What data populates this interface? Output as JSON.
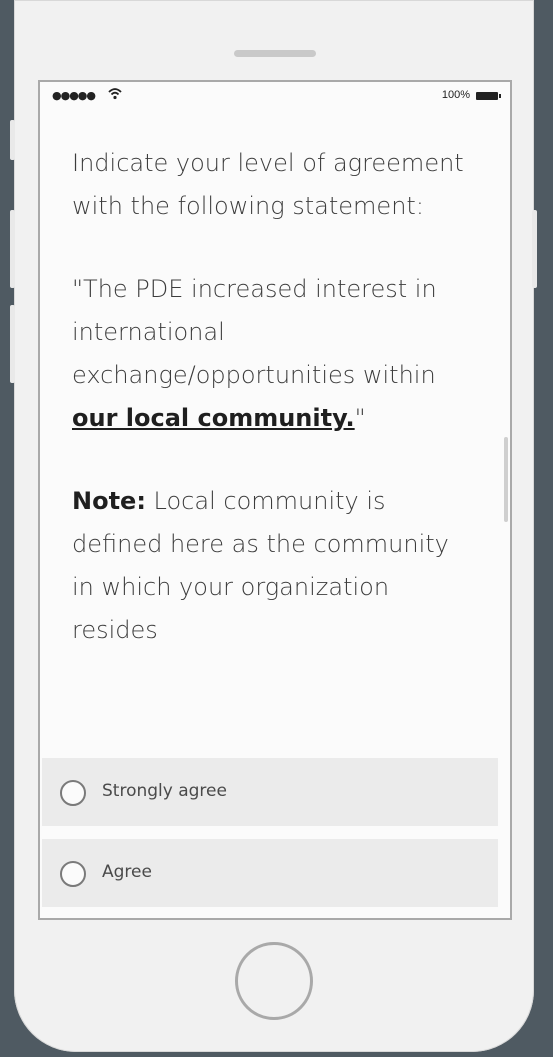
{
  "status_bar": {
    "signal": "●●●●●",
    "battery_percent": "100%"
  },
  "question": {
    "prompt": "Indicate your level of agreement with the following statement:",
    "statement_pre": "\"The PDE increased interest in international exchange/opportunities within ",
    "statement_emph": "our local community.",
    "statement_post": "\"",
    "note_label": "Note:",
    "note_text": " Local community is defined here as the community in which your organization resides"
  },
  "options": [
    {
      "label": "Strongly agree",
      "selected": false
    },
    {
      "label": "Agree",
      "selected": false
    }
  ],
  "colors": {
    "background": "#4f5a62",
    "phone_body": "#f1f1f1",
    "option_background": "#ebebeb"
  }
}
